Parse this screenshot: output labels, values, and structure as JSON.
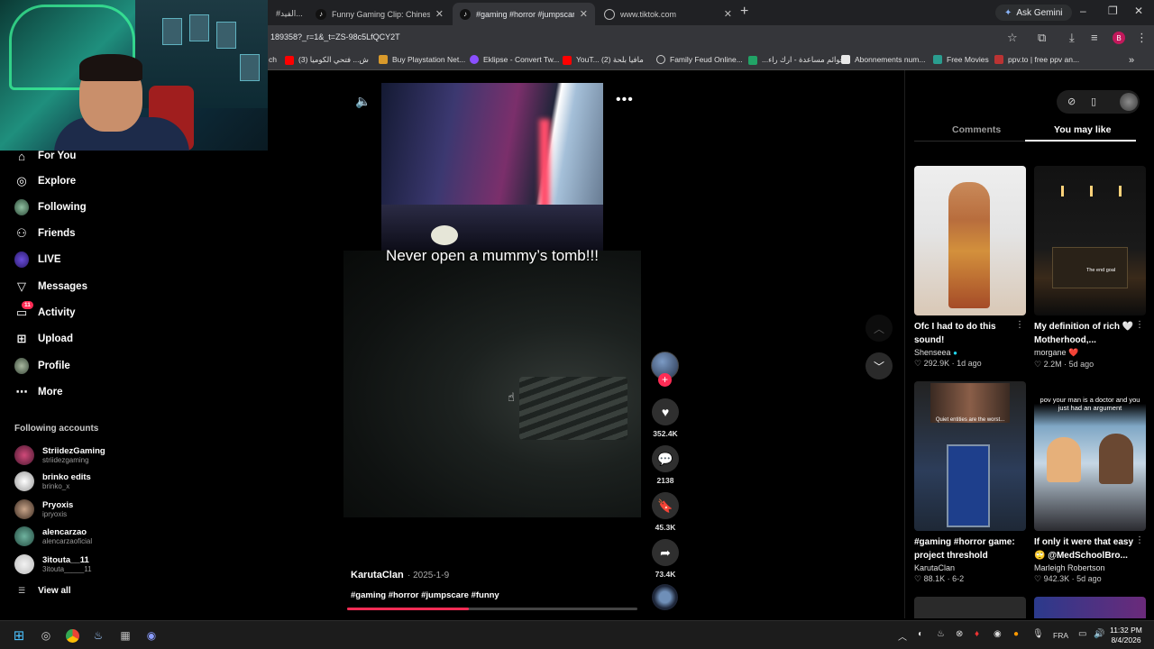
{
  "browser": {
    "tabs": [
      {
        "title": "#الفيد..."
      },
      {
        "title": "Funny Gaming Clip: Chinese Pla..."
      },
      {
        "title": "#gaming #horror #jumpscare #"
      },
      {
        "title": "www.tiktok.com"
      }
    ],
    "ask_gemini": "Ask Gemini",
    "url": "189358?_r=1&_t=ZS-98c5LfQCY2T",
    "profile_initial": "B",
    "bookmarks": [
      "ch",
      "ش... فتحي الكوميا (3)",
      "Buy Playstation Net...",
      "Eklipse - Convert Tw...",
      "YouT... مافيا بلحة (2)",
      "Family Feud Online...",
      "...قوائم مساعدة - ارك راء",
      "Abonnements num...",
      "Free Movies",
      "ppv.to | free ppv an..."
    ]
  },
  "sidebar": {
    "nav": [
      {
        "label": "For You",
        "icon": "home-icon"
      },
      {
        "label": "Explore",
        "icon": "compass-icon"
      },
      {
        "label": "Following",
        "icon": "following-avatar"
      },
      {
        "label": "Friends",
        "icon": "friends-icon"
      },
      {
        "label": "LIVE",
        "icon": "live-icon"
      },
      {
        "label": "Messages",
        "icon": "messages-icon"
      },
      {
        "label": "Activity",
        "icon": "activity-icon",
        "badge": "11"
      },
      {
        "label": "Upload",
        "icon": "upload-icon"
      },
      {
        "label": "Profile",
        "icon": "profile-avatar"
      },
      {
        "label": "More",
        "icon": "more-icon"
      }
    ],
    "following_title": "Following accounts",
    "accounts": [
      {
        "name": "StriidezGaming",
        "handle": "striidezgaming"
      },
      {
        "name": "brinko edits",
        "handle": "brinko_x"
      },
      {
        "name": "Pryoxis",
        "handle": "ipryoxis"
      },
      {
        "name": "alencarzao",
        "handle": "alencarzaoficial"
      },
      {
        "name": "3itouta__11",
        "handle": "3itouta_____11"
      }
    ],
    "view_all": "View all"
  },
  "video": {
    "caption": "Never open a mummy’s tomb!!!",
    "author": "KarutaClan",
    "date": "· 2025-1-9",
    "tags": "#gaming #horror #jumpscare #funny",
    "progress": 0.42,
    "actions": {
      "likes": "352.4K",
      "comments": "2138",
      "saves": "45.3K",
      "shares": "73.4K"
    }
  },
  "right_panel": {
    "tabs": [
      "Comments",
      "You may like"
    ],
    "active_tab": "You may like",
    "cards": [
      {
        "title": "Ofc I had to do this sound!",
        "author": "Shenseea",
        "likes": "292.9K",
        "age": "1d ago",
        "verified": true
      },
      {
        "title": "My definition of rich 🤍 Motherhood,...",
        "author": "morgane",
        "likes": "2.2M",
        "age": "5d ago",
        "author_suffix": "❤️"
      },
      {
        "title": "#gaming #horror game: project threshold",
        "author": "KarutaClan",
        "likes": "88.1K",
        "age": "6-2"
      },
      {
        "title": "If only it were that easy 🙄 @MedSchoolBro...",
        "author": "Marleigh Robertson",
        "likes": "942.3K",
        "age": "5d ago"
      }
    ],
    "thumb_texts": {
      "card2": "The end goal",
      "card3": "Quiet entities are the worst...",
      "card4": "pov your man is a doctor and you just had an argument"
    }
  },
  "taskbar": {
    "language": "FRA",
    "time": "11:32 PM",
    "date": "8/4/2026"
  },
  "colors": {
    "accent": "#fe2c55",
    "bg": "#000000",
    "verified": "#20d5ec"
  }
}
